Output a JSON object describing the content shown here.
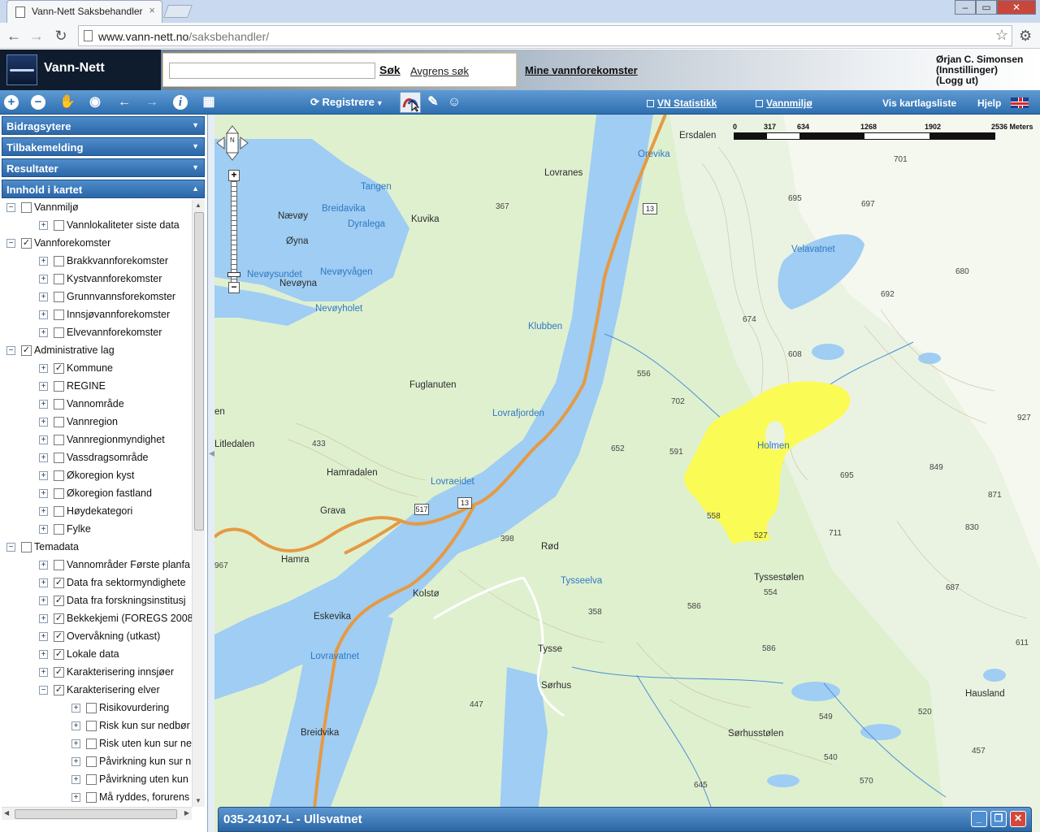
{
  "browser": {
    "tab_title": "Vann-Nett Saksbehandler",
    "url_host": "www.vann-nett.no",
    "url_path": "/saksbehandler/"
  },
  "header": {
    "logo_text": "Vann-Nett",
    "search_value": "",
    "search_button": "Søk",
    "refine_link": "Avgrens søk",
    "my_waters_link": "Mine vannforekomster",
    "user_name": "Ørjan C. Simonsen",
    "settings_link": "(Innstillinger)",
    "logout_link": "(Logg ut)"
  },
  "toolbar": {
    "registrere_label": "Registrere",
    "vn_statistikk": "VN Statistikk",
    "vannmiljo": "Vannmiljø",
    "layer_list": "Vis kartlagsliste",
    "help": "Hjelp"
  },
  "left_panel": {
    "sections": [
      "Bidragsytere",
      "Tilbakemelding",
      "Resultater",
      "Innhold i kartet"
    ],
    "tree": [
      {
        "label": "Vannmiljø",
        "level": 0,
        "checked": false,
        "expander": "−"
      },
      {
        "label": "Vannlokaliteter siste data",
        "level": 1,
        "checked": false,
        "expander": "+"
      },
      {
        "label": "Vannforekomster",
        "level": 0,
        "checked": true,
        "expander": "−"
      },
      {
        "label": "Brakkvannforekomster",
        "level": 1,
        "checked": false,
        "expander": "+"
      },
      {
        "label": "Kystvannforekomster",
        "level": 1,
        "checked": false,
        "expander": "+"
      },
      {
        "label": "Grunnvannsforekomster",
        "level": 1,
        "checked": false,
        "expander": "+"
      },
      {
        "label": "Innsjøvannforekomster",
        "level": 1,
        "checked": false,
        "expander": "+"
      },
      {
        "label": "Elvevannforekomster",
        "level": 1,
        "checked": false,
        "expander": "+"
      },
      {
        "label": "Administrative lag",
        "level": 0,
        "checked": true,
        "expander": "−"
      },
      {
        "label": "Kommune",
        "level": 1,
        "checked": true,
        "expander": "+"
      },
      {
        "label": "REGINE",
        "level": 1,
        "checked": false,
        "expander": "+"
      },
      {
        "label": "Vannområde",
        "level": 1,
        "checked": false,
        "expander": "+"
      },
      {
        "label": "Vannregion",
        "level": 1,
        "checked": false,
        "expander": "+"
      },
      {
        "label": "Vannregionmyndighet",
        "level": 1,
        "checked": false,
        "expander": "+"
      },
      {
        "label": "Vassdragsområde",
        "level": 1,
        "checked": false,
        "expander": "+"
      },
      {
        "label": "Økoregion kyst",
        "level": 1,
        "checked": false,
        "expander": "+"
      },
      {
        "label": "Økoregion fastland",
        "level": 1,
        "checked": false,
        "expander": "+"
      },
      {
        "label": "Høydekategori",
        "level": 1,
        "checked": false,
        "expander": "+"
      },
      {
        "label": "Fylke",
        "level": 1,
        "checked": false,
        "expander": "+"
      },
      {
        "label": "Temadata",
        "level": 0,
        "checked": false,
        "expander": "−"
      },
      {
        "label": "Vannområder Første planfa",
        "level": 1,
        "checked": false,
        "expander": "+"
      },
      {
        "label": "Data fra sektormyndighete",
        "level": 1,
        "checked": true,
        "expander": "+"
      },
      {
        "label": "Data fra forskningsinstitusj",
        "level": 1,
        "checked": true,
        "expander": "+"
      },
      {
        "label": "Bekkekjemi (FOREGS 2008",
        "level": 1,
        "checked": true,
        "expander": "+"
      },
      {
        "label": "Overvåkning (utkast)",
        "level": 1,
        "checked": true,
        "expander": "+"
      },
      {
        "label": "Lokale data",
        "level": 1,
        "checked": true,
        "expander": "+"
      },
      {
        "label": "Karakterisering innsjøer",
        "level": 1,
        "checked": true,
        "expander": "+"
      },
      {
        "label": "Karakterisering elver",
        "level": 1,
        "checked": true,
        "expander": "−"
      },
      {
        "label": "Risikovurdering",
        "level": 2,
        "checked": false,
        "expander": "+"
      },
      {
        "label": "Risk kun sur nedbør",
        "level": 2,
        "checked": false,
        "expander": "+"
      },
      {
        "label": "Risk uten kun sur ne",
        "level": 2,
        "checked": false,
        "expander": "+"
      },
      {
        "label": "Påvirkning kun sur n",
        "level": 2,
        "checked": false,
        "expander": "+"
      },
      {
        "label": "Påvirkning uten kun",
        "level": 2,
        "checked": false,
        "expander": "+"
      },
      {
        "label": "Må ryddes, forurens",
        "level": 2,
        "checked": false,
        "expander": "+"
      }
    ]
  },
  "map": {
    "scale_ticks": [
      "0",
      "317",
      "634",
      "1268",
      "1902",
      "2536 Meters"
    ],
    "pan_north": "N",
    "zoom_in": "+",
    "zoom_out": "−",
    "place_labels": [
      {
        "text": "Ersdalen",
        "type": "place"
      },
      {
        "text": "Orevika",
        "type": "water"
      },
      {
        "text": "Lovranes",
        "type": "place"
      },
      {
        "text": "Tangen",
        "type": "water"
      },
      {
        "text": "Breidavika",
        "type": "water"
      },
      {
        "text": "Dyralega",
        "type": "water"
      },
      {
        "text": "Nævøy",
        "type": "place"
      },
      {
        "text": "Kuvika",
        "type": "place"
      },
      {
        "text": "Øyna",
        "type": "place"
      },
      {
        "text": "Nevøysundet",
        "type": "water"
      },
      {
        "text": "Nevøyvågen",
        "type": "water"
      },
      {
        "text": "Nevøyna",
        "type": "place"
      },
      {
        "text": "Nevøyholet",
        "type": "water"
      },
      {
        "text": "Klubben",
        "type": "water"
      },
      {
        "text": "Velavatnet",
        "type": "water"
      },
      {
        "text": "Fuglanuten",
        "type": "place"
      },
      {
        "text": "Lovrafjorden",
        "type": "water"
      },
      {
        "text": "Litledalen",
        "type": "place"
      },
      {
        "text": "Hamradalen",
        "type": "place"
      },
      {
        "text": "Lovraeidet",
        "type": "water"
      },
      {
        "text": "Grava",
        "type": "place"
      },
      {
        "text": "Hamra",
        "type": "place"
      },
      {
        "text": "Rød",
        "type": "place"
      },
      {
        "text": "Tysseelva",
        "type": "water"
      },
      {
        "text": "Kolstø",
        "type": "place"
      },
      {
        "text": "Tyssestølen",
        "type": "place"
      },
      {
        "text": "Eskevika",
        "type": "place"
      },
      {
        "text": "Tysse",
        "type": "place"
      },
      {
        "text": "Lovravatnet",
        "type": "water"
      },
      {
        "text": "Sørhus",
        "type": "place"
      },
      {
        "text": "Hausland",
        "type": "place"
      },
      {
        "text": "Breidvika",
        "type": "place"
      },
      {
        "text": "Sørhusstølen",
        "type": "place"
      },
      {
        "text": "Holmen",
        "type": "water"
      },
      {
        "text": "en",
        "type": "place"
      }
    ],
    "heights": [
      "701",
      "695",
      "697",
      "367",
      "680",
      "692",
      "674",
      "608",
      "556",
      "702",
      "652",
      "591",
      "433",
      "849",
      "695",
      "927",
      "871",
      "558",
      "527",
      "830",
      "711",
      "398",
      "687",
      "358",
      "586",
      "554",
      "586",
      "611",
      "447",
      "549",
      "520",
      "540",
      "457",
      "570",
      "645",
      "967"
    ],
    "road_numbers": [
      "13",
      "13",
      "517"
    ]
  },
  "dialog": {
    "title": "035-24107-L - Ullsvatnet",
    "min": "_",
    "max": "❐",
    "close": "✕"
  },
  "colors": {
    "accent": "#2e6fb0",
    "selection": "#fbfb55",
    "water": "#9fcdf3",
    "road": "#e59a43"
  }
}
